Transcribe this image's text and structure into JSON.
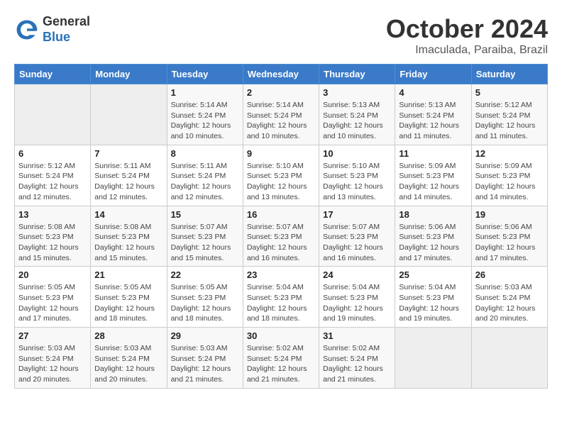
{
  "logo": {
    "general": "General",
    "blue": "Blue"
  },
  "header": {
    "month": "October 2024",
    "location": "Imaculada, Paraiba, Brazil"
  },
  "weekdays": [
    "Sunday",
    "Monday",
    "Tuesday",
    "Wednesday",
    "Thursday",
    "Friday",
    "Saturday"
  ],
  "weeks": [
    [
      {
        "day": "",
        "empty": true
      },
      {
        "day": "",
        "empty": true
      },
      {
        "day": "1",
        "sunrise": "Sunrise: 5:14 AM",
        "sunset": "Sunset: 5:24 PM",
        "daylight": "Daylight: 12 hours and 10 minutes."
      },
      {
        "day": "2",
        "sunrise": "Sunrise: 5:14 AM",
        "sunset": "Sunset: 5:24 PM",
        "daylight": "Daylight: 12 hours and 10 minutes."
      },
      {
        "day": "3",
        "sunrise": "Sunrise: 5:13 AM",
        "sunset": "Sunset: 5:24 PM",
        "daylight": "Daylight: 12 hours and 10 minutes."
      },
      {
        "day": "4",
        "sunrise": "Sunrise: 5:13 AM",
        "sunset": "Sunset: 5:24 PM",
        "daylight": "Daylight: 12 hours and 11 minutes."
      },
      {
        "day": "5",
        "sunrise": "Sunrise: 5:12 AM",
        "sunset": "Sunset: 5:24 PM",
        "daylight": "Daylight: 12 hours and 11 minutes."
      }
    ],
    [
      {
        "day": "6",
        "sunrise": "Sunrise: 5:12 AM",
        "sunset": "Sunset: 5:24 PM",
        "daylight": "Daylight: 12 hours and 12 minutes."
      },
      {
        "day": "7",
        "sunrise": "Sunrise: 5:11 AM",
        "sunset": "Sunset: 5:24 PM",
        "daylight": "Daylight: 12 hours and 12 minutes."
      },
      {
        "day": "8",
        "sunrise": "Sunrise: 5:11 AM",
        "sunset": "Sunset: 5:24 PM",
        "daylight": "Daylight: 12 hours and 12 minutes."
      },
      {
        "day": "9",
        "sunrise": "Sunrise: 5:10 AM",
        "sunset": "Sunset: 5:23 PM",
        "daylight": "Daylight: 12 hours and 13 minutes."
      },
      {
        "day": "10",
        "sunrise": "Sunrise: 5:10 AM",
        "sunset": "Sunset: 5:23 PM",
        "daylight": "Daylight: 12 hours and 13 minutes."
      },
      {
        "day": "11",
        "sunrise": "Sunrise: 5:09 AM",
        "sunset": "Sunset: 5:23 PM",
        "daylight": "Daylight: 12 hours and 14 minutes."
      },
      {
        "day": "12",
        "sunrise": "Sunrise: 5:09 AM",
        "sunset": "Sunset: 5:23 PM",
        "daylight": "Daylight: 12 hours and 14 minutes."
      }
    ],
    [
      {
        "day": "13",
        "sunrise": "Sunrise: 5:08 AM",
        "sunset": "Sunset: 5:23 PM",
        "daylight": "Daylight: 12 hours and 15 minutes."
      },
      {
        "day": "14",
        "sunrise": "Sunrise: 5:08 AM",
        "sunset": "Sunset: 5:23 PM",
        "daylight": "Daylight: 12 hours and 15 minutes."
      },
      {
        "day": "15",
        "sunrise": "Sunrise: 5:07 AM",
        "sunset": "Sunset: 5:23 PM",
        "daylight": "Daylight: 12 hours and 15 minutes."
      },
      {
        "day": "16",
        "sunrise": "Sunrise: 5:07 AM",
        "sunset": "Sunset: 5:23 PM",
        "daylight": "Daylight: 12 hours and 16 minutes."
      },
      {
        "day": "17",
        "sunrise": "Sunrise: 5:07 AM",
        "sunset": "Sunset: 5:23 PM",
        "daylight": "Daylight: 12 hours and 16 minutes."
      },
      {
        "day": "18",
        "sunrise": "Sunrise: 5:06 AM",
        "sunset": "Sunset: 5:23 PM",
        "daylight": "Daylight: 12 hours and 17 minutes."
      },
      {
        "day": "19",
        "sunrise": "Sunrise: 5:06 AM",
        "sunset": "Sunset: 5:23 PM",
        "daylight": "Daylight: 12 hours and 17 minutes."
      }
    ],
    [
      {
        "day": "20",
        "sunrise": "Sunrise: 5:05 AM",
        "sunset": "Sunset: 5:23 PM",
        "daylight": "Daylight: 12 hours and 17 minutes."
      },
      {
        "day": "21",
        "sunrise": "Sunrise: 5:05 AM",
        "sunset": "Sunset: 5:23 PM",
        "daylight": "Daylight: 12 hours and 18 minutes."
      },
      {
        "day": "22",
        "sunrise": "Sunrise: 5:05 AM",
        "sunset": "Sunset: 5:23 PM",
        "daylight": "Daylight: 12 hours and 18 minutes."
      },
      {
        "day": "23",
        "sunrise": "Sunrise: 5:04 AM",
        "sunset": "Sunset: 5:23 PM",
        "daylight": "Daylight: 12 hours and 18 minutes."
      },
      {
        "day": "24",
        "sunrise": "Sunrise: 5:04 AM",
        "sunset": "Sunset: 5:23 PM",
        "daylight": "Daylight: 12 hours and 19 minutes."
      },
      {
        "day": "25",
        "sunrise": "Sunrise: 5:04 AM",
        "sunset": "Sunset: 5:23 PM",
        "daylight": "Daylight: 12 hours and 19 minutes."
      },
      {
        "day": "26",
        "sunrise": "Sunrise: 5:03 AM",
        "sunset": "Sunset: 5:24 PM",
        "daylight": "Daylight: 12 hours and 20 minutes."
      }
    ],
    [
      {
        "day": "27",
        "sunrise": "Sunrise: 5:03 AM",
        "sunset": "Sunset: 5:24 PM",
        "daylight": "Daylight: 12 hours and 20 minutes."
      },
      {
        "day": "28",
        "sunrise": "Sunrise: 5:03 AM",
        "sunset": "Sunset: 5:24 PM",
        "daylight": "Daylight: 12 hours and 20 minutes."
      },
      {
        "day": "29",
        "sunrise": "Sunrise: 5:03 AM",
        "sunset": "Sunset: 5:24 PM",
        "daylight": "Daylight: 12 hours and 21 minutes."
      },
      {
        "day": "30",
        "sunrise": "Sunrise: 5:02 AM",
        "sunset": "Sunset: 5:24 PM",
        "daylight": "Daylight: 12 hours and 21 minutes."
      },
      {
        "day": "31",
        "sunrise": "Sunrise: 5:02 AM",
        "sunset": "Sunset: 5:24 PM",
        "daylight": "Daylight: 12 hours and 21 minutes."
      },
      {
        "day": "",
        "empty": true
      },
      {
        "day": "",
        "empty": true
      }
    ]
  ]
}
